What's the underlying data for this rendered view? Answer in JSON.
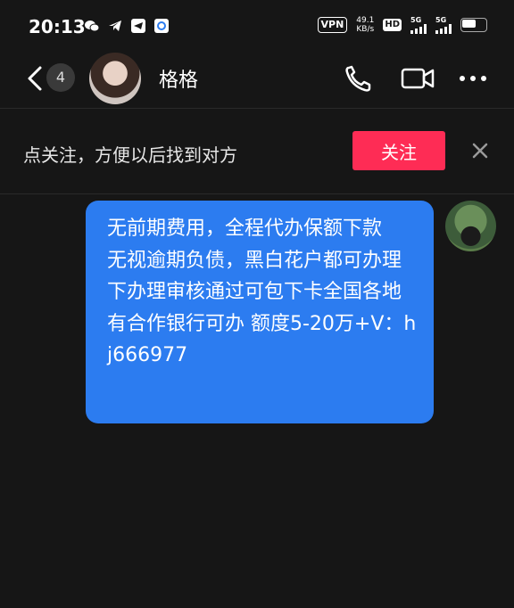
{
  "status_bar": {
    "time": "20:13",
    "vpn": "VPN",
    "net_speed_value": "49.1",
    "net_speed_unit": "KB/s",
    "hd": "HD",
    "sim1": "5G",
    "sim2": "5G"
  },
  "header": {
    "unread_count": "4",
    "contact_name": "格格"
  },
  "follow_bar": {
    "prompt": "点关注，方便以后找到对方",
    "follow_label": "关注"
  },
  "message": {
    "text": "无前期费用，全程代办保额下款\n无视逾期负债，黑白花户都可办理下办理审核通过可包下卡全国各地有合作银行可办 额度5-20万+V：hj666977"
  },
  "colors": {
    "background": "#161616",
    "bubble": "#2c7cf0",
    "follow_button": "#fe2c55"
  }
}
